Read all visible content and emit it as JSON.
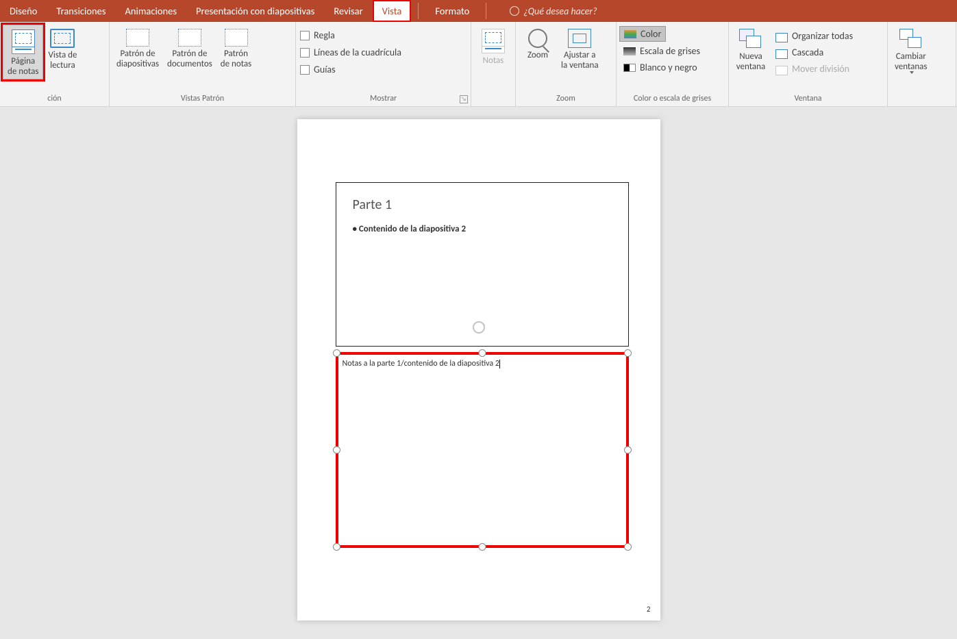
{
  "tabs": {
    "diseno": "Diseño",
    "transiciones": "Transiciones",
    "animaciones": "Animaciones",
    "presentacion": "Presentación con diapositivas",
    "revisar": "Revisar",
    "vista": "Vista",
    "formato": "Formato"
  },
  "search": {
    "placeholder": "¿Qué desea hacer?"
  },
  "groups": {
    "presentacion_truncated": "ción",
    "vistas_patron": "Vistas Patrón",
    "mostrar": "Mostrar",
    "zoom": "Zoom",
    "color": "Color o escala de grises",
    "ventana": "Ventana"
  },
  "buttons": {
    "pagina_notas": "Página\nde notas",
    "vista_lectura": "Vista de\nlectura",
    "patron_diap": "Patrón de\ndiapositivas",
    "patron_doc": "Patrón de\ndocumentos",
    "patron_notas": "Patrón\nde notas",
    "notas": "Notas",
    "zoom": "Zoom",
    "ajustar": "Ajustar a\nla ventana",
    "nueva_ventana": "Nueva\nventana",
    "cambiar_ventanas": "Cambiar\nventanas"
  },
  "checks": {
    "regla": "Regla",
    "cuadricula": "Líneas de la cuadrícula",
    "guias": "Guías"
  },
  "color": {
    "color": "Color",
    "grises": "Escala de grises",
    "byn": "Blanco y negro"
  },
  "ventana": {
    "organizar": "Organizar todas",
    "cascada": "Cascada",
    "mover": "Mover división"
  },
  "slide": {
    "title": "Parte 1",
    "bullet": "Contenido de la diapositiva 2"
  },
  "notes": {
    "text": "Notas a la parte 1/contenido de la diapositiva 2"
  },
  "page_number": "2"
}
